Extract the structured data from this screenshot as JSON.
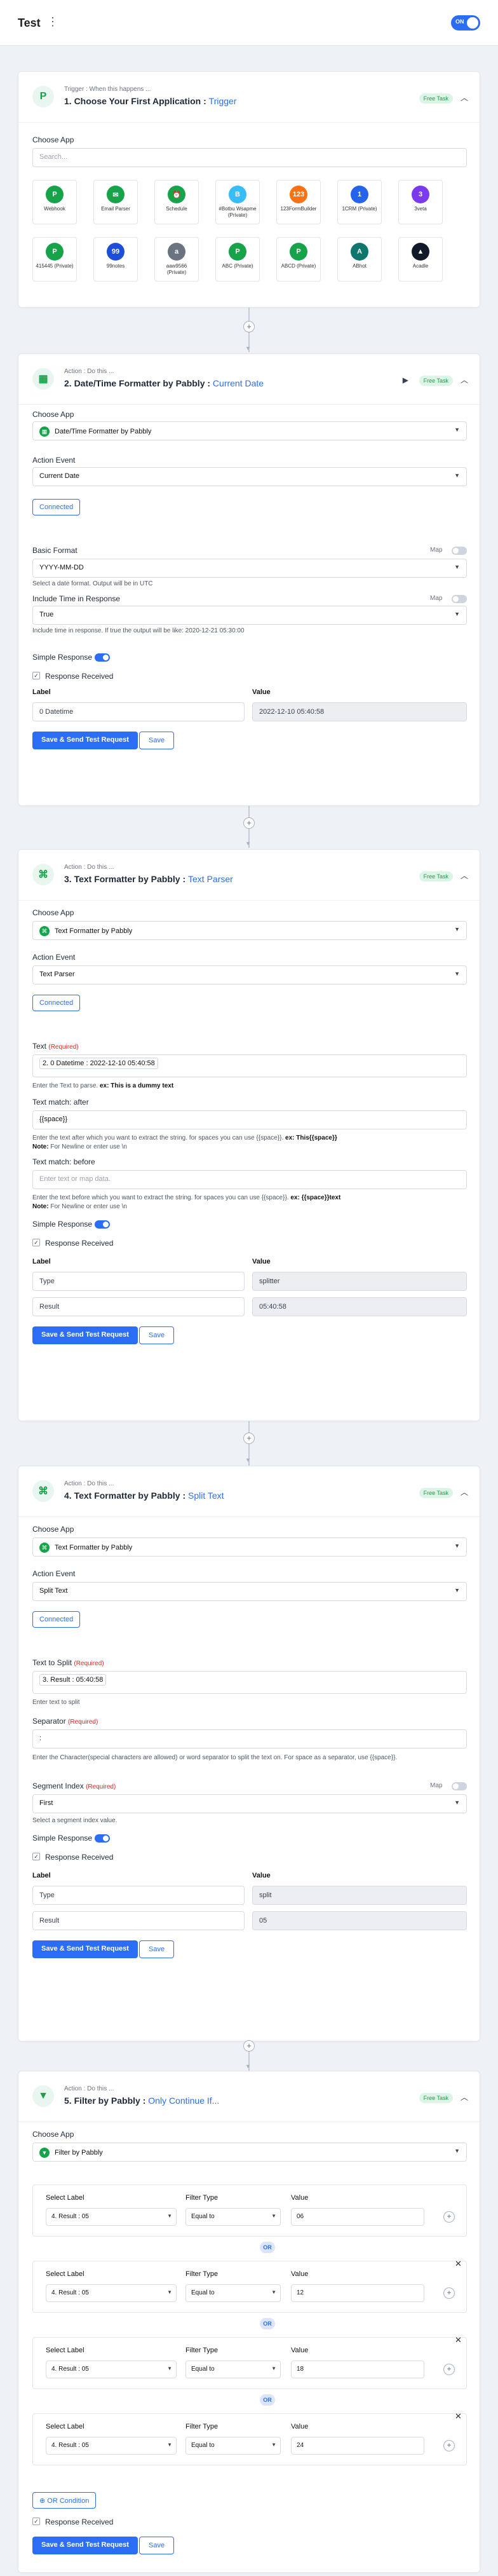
{
  "header": {
    "title": "Test",
    "menu": "⋮",
    "toggle": "ON"
  },
  "common": {
    "choose_app": "Choose App",
    "action_event": "Action Event",
    "connected": "Connected",
    "free_task": "Free Task",
    "simple_response": "Simple Response",
    "response_received": "Response Received",
    "label": "Label",
    "value": "Value",
    "save_send": "Save & Send Test Request",
    "save": "Save",
    "map": "Map",
    "required": "(Required)",
    "action_kicker": "Action : Do this ...",
    "action_kicker2": "Action : Do this ..."
  },
  "trigger": {
    "kicker": "Trigger : When this happens ...",
    "heading": "1. Choose Your First Application :",
    "sub": "Trigger",
    "search_placeholder": "Search...",
    "apps": [
      {
        "name": "Webhook",
        "color": "#16a34a",
        "glyph": "P"
      },
      {
        "name": "Email Parser",
        "color": "#16a34a",
        "glyph": "✉"
      },
      {
        "name": "Schedule",
        "color": "#16a34a",
        "glyph": "⏰"
      },
      {
        "name": "#Botbu Wsapme (Private)",
        "color": "#38bdf8",
        "glyph": "B"
      },
      {
        "name": "123FormBuilder",
        "color": "#f97316",
        "glyph": "123"
      },
      {
        "name": "1CRM (Private)",
        "color": "#2563eb",
        "glyph": "1"
      },
      {
        "name": "3veta",
        "color": "#7c3aed",
        "glyph": "3"
      },
      {
        "name": "415445 (Private)",
        "color": "#16a34a",
        "glyph": "P"
      },
      {
        "name": "99notes",
        "color": "#1d4ed8",
        "glyph": "99"
      },
      {
        "name": "aaw9566 (Private)",
        "color": "#6b7280",
        "glyph": "a"
      },
      {
        "name": "ABC (Private)",
        "color": "#16a34a",
        "glyph": "P"
      },
      {
        "name": "ABCD (Private)",
        "color": "#16a34a",
        "glyph": "P"
      },
      {
        "name": "ABhot",
        "color": "#0f766e",
        "glyph": "A"
      },
      {
        "name": "Acadle",
        "color": "#111827",
        "glyph": "▲"
      }
    ]
  },
  "step2": {
    "heading": "2. Date/Time Formatter by Pabbly :",
    "sub": "Current Date",
    "app": "Date/Time Formatter by Pabbly",
    "event": "Current Date",
    "basic_format_label": "Basic Format",
    "basic_format": "YYYY-MM-DD",
    "basic_help": "Select a date format. Output will be in UTC",
    "include_time_label": "Include Time in Response",
    "include_time": "True",
    "include_help": "Include time in response. If true the output will be like: 2020-12-21 05:30:00",
    "rows": [
      {
        "label": "0 Datetime",
        "value": "2022-12-10 05:40:58"
      }
    ]
  },
  "step3": {
    "heading": "3. Text Formatter by Pabbly :",
    "sub": "Text Parser",
    "app": "Text Formatter by Pabbly",
    "event": "Text Parser",
    "text_label": "Text",
    "text_value": "2. 0 Datetime : 2022-12-10 05:40:58",
    "text_help": "Enter the Text to parse.",
    "text_help_b": "ex: This is a dummy text",
    "after_label": "Text match: after",
    "after_value": "{{space}}",
    "after_help": "Enter the text after which you want to extract the string. for spaces you can use {{space}}.",
    "after_help_b": "ex: This{{space}}",
    "note_b": "Note:",
    "note": "For Newline or enter use \\n",
    "before_label": "Text match: before",
    "before_placeholder": "Enter text or map data.",
    "before_help": "Enter the text before which you want to extract the string. for spaces you can use {{space}}.",
    "before_help_b": "ex: {{space}}text",
    "rows": [
      {
        "label": "Type",
        "value": "splitter"
      },
      {
        "label": "Result",
        "value": "05:40:58"
      }
    ]
  },
  "step4": {
    "heading": "4. Text Formatter by Pabbly :",
    "sub": "Split Text",
    "app": "Text Formatter by Pabbly",
    "event": "Split Text",
    "split_label": "Text to Split",
    "split_value": "3. Result : 05:40:58",
    "split_help": "Enter text to split",
    "sep_label": "Separator",
    "sep_value": ":",
    "sep_help": "Enter the Character(special characters are allowed) or word separator to split the text on. For space as a separator, use {{space}}.",
    "seg_label": "Segment Index",
    "seg_value": "First",
    "seg_help": "Select a segment index value.",
    "rows": [
      {
        "label": "Type",
        "value": "split"
      },
      {
        "label": "Result",
        "value": "05"
      }
    ]
  },
  "step5": {
    "heading": "5. Filter by Pabbly :",
    "sub": "Only Continue If...",
    "app": "Filter by Pabbly",
    "select_label": "Select Label",
    "filter_type": "Filter Type",
    "value": "Value",
    "or": "OR",
    "or_condition": "OR Condition",
    "conditions": [
      {
        "label": "4. Result : 05",
        "type": "Equal to",
        "value": "06"
      },
      {
        "label": "4. Result : 05",
        "type": "Equal to",
        "value": "12"
      },
      {
        "label": "4. Result : 05",
        "type": "Equal to",
        "value": "18"
      },
      {
        "label": "4. Result : 05",
        "type": "Equal to",
        "value": "24"
      }
    ]
  }
}
